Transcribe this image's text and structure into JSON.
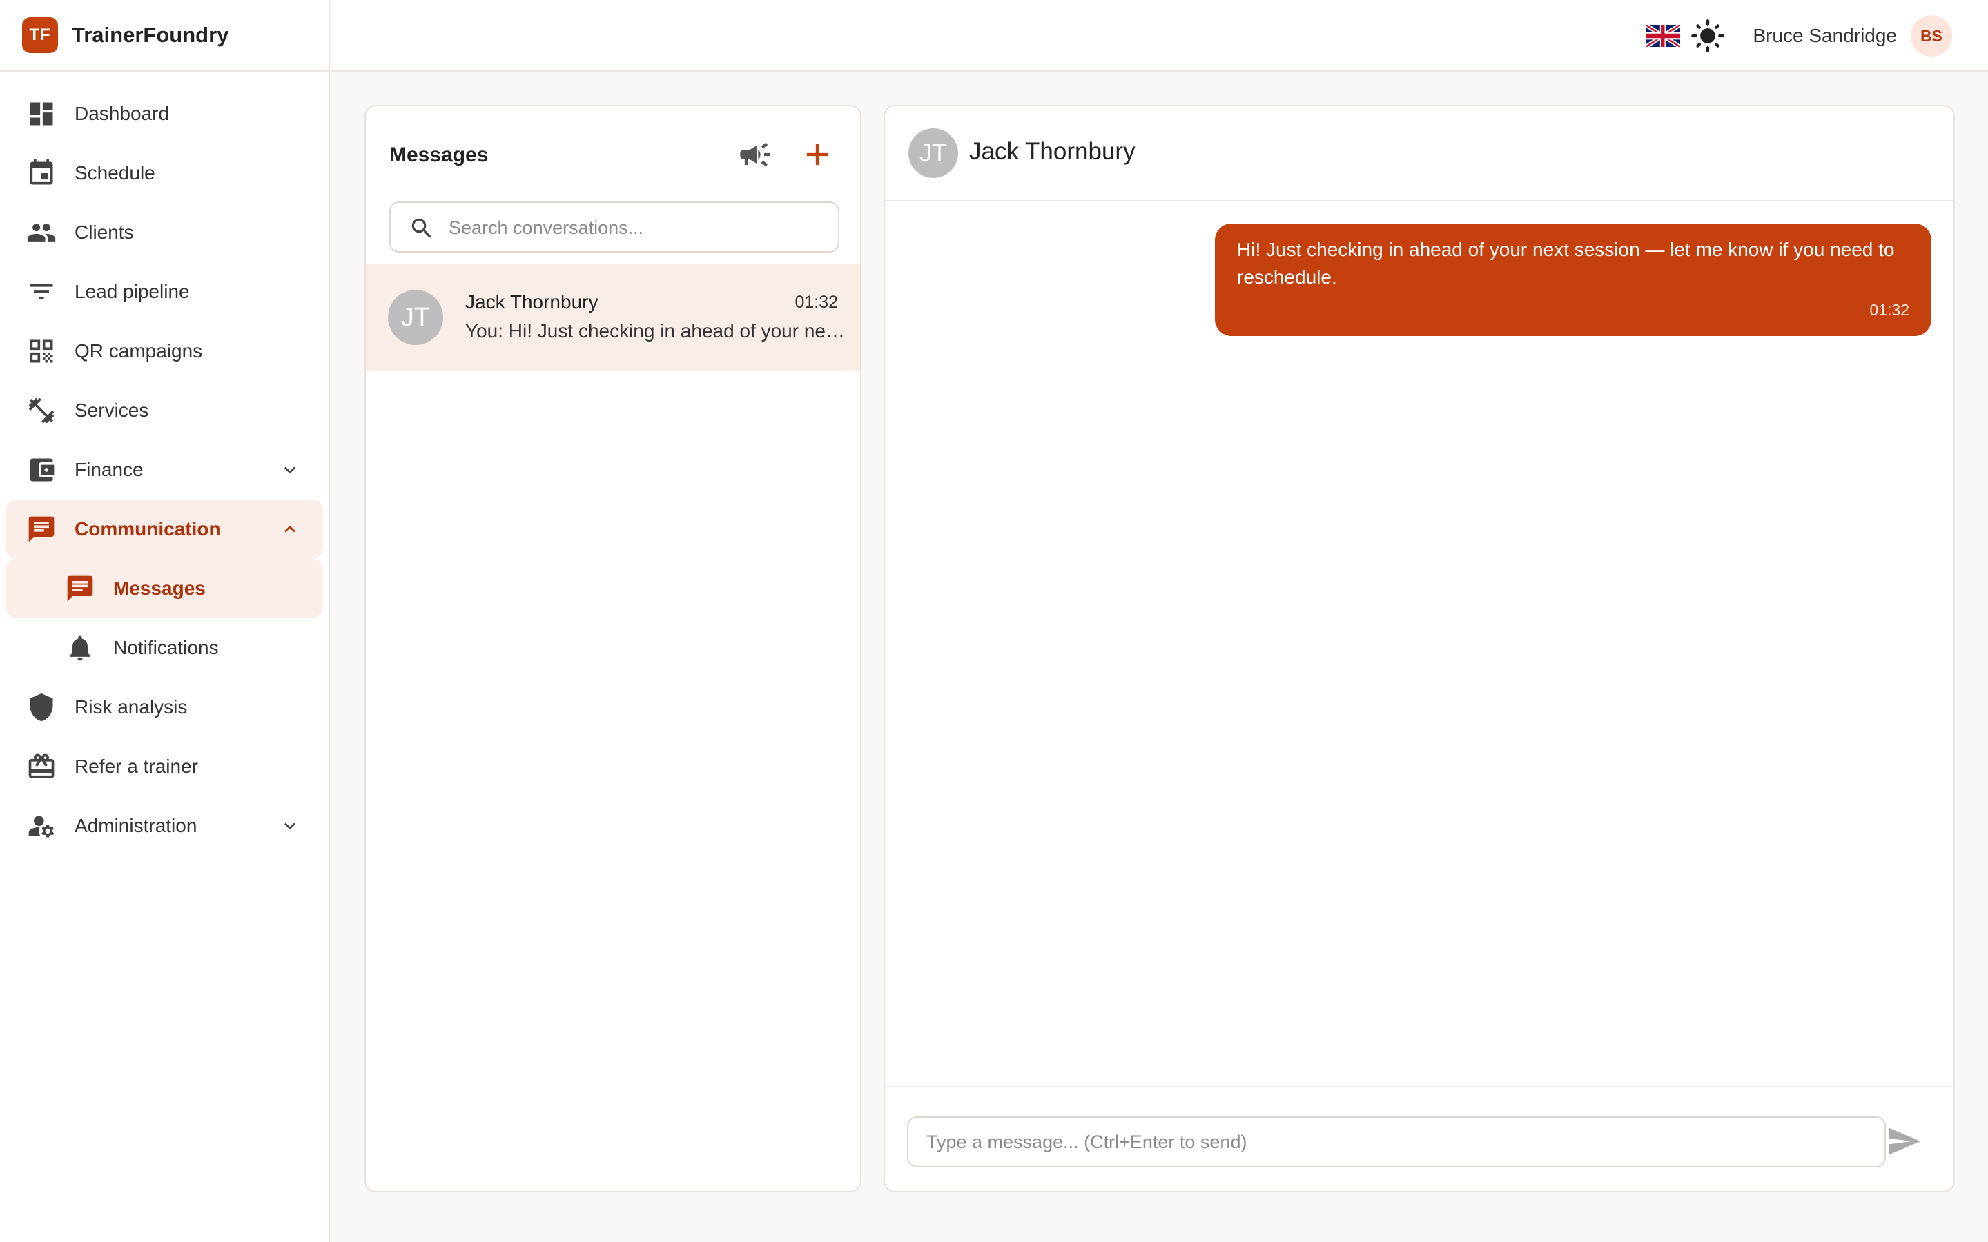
{
  "brand": {
    "logo_text": "TF",
    "name": "TrainerFoundry"
  },
  "sidebar": {
    "items": [
      {
        "label": "Dashboard",
        "icon": "dashboard-icon"
      },
      {
        "label": "Schedule",
        "icon": "calendar-icon"
      },
      {
        "label": "Clients",
        "icon": "people-icon"
      },
      {
        "label": "Lead pipeline",
        "icon": "filter-icon"
      },
      {
        "label": "QR campaigns",
        "icon": "qr-code-icon"
      },
      {
        "label": "Services",
        "icon": "dumbbell-icon"
      },
      {
        "label": "Finance",
        "icon": "wallet-icon"
      },
      {
        "label": "Communication",
        "icon": "chat-icon"
      },
      {
        "label": "Messages",
        "icon": "chat-icon"
      },
      {
        "label": "Notifications",
        "icon": "bell-icon"
      },
      {
        "label": "Risk analysis",
        "icon": "shield-icon"
      },
      {
        "label": "Refer a trainer",
        "icon": "gift-card-icon"
      },
      {
        "label": "Administration",
        "icon": "admin-settings-icon"
      }
    ]
  },
  "header": {
    "user_name": "Bruce Sandridge",
    "user_initials": "BS",
    "language_icon": "uk-flag-icon",
    "theme_icon": "sun-icon"
  },
  "messages": {
    "title": "Messages",
    "search_placeholder": "Search conversations...",
    "conversations": [
      {
        "initials": "JT",
        "name": "Jack Thornbury",
        "time": "01:32",
        "preview": "You: Hi! Just checking in ahead of your next session — let me know if you need to reschedule."
      }
    ]
  },
  "chat": {
    "contact_initials": "JT",
    "contact_name": "Jack Thornbury",
    "messages": [
      {
        "text": "Hi! Just checking in ahead of your next session — let me know if you need to reschedule.",
        "time": "01:32"
      }
    ],
    "input_placeholder": "Type a message... (Ctrl+Enter to send)"
  },
  "colors": {
    "accent": "#c4410e",
    "active_bg": "#fbeee8",
    "active_text": "#a8330b"
  }
}
